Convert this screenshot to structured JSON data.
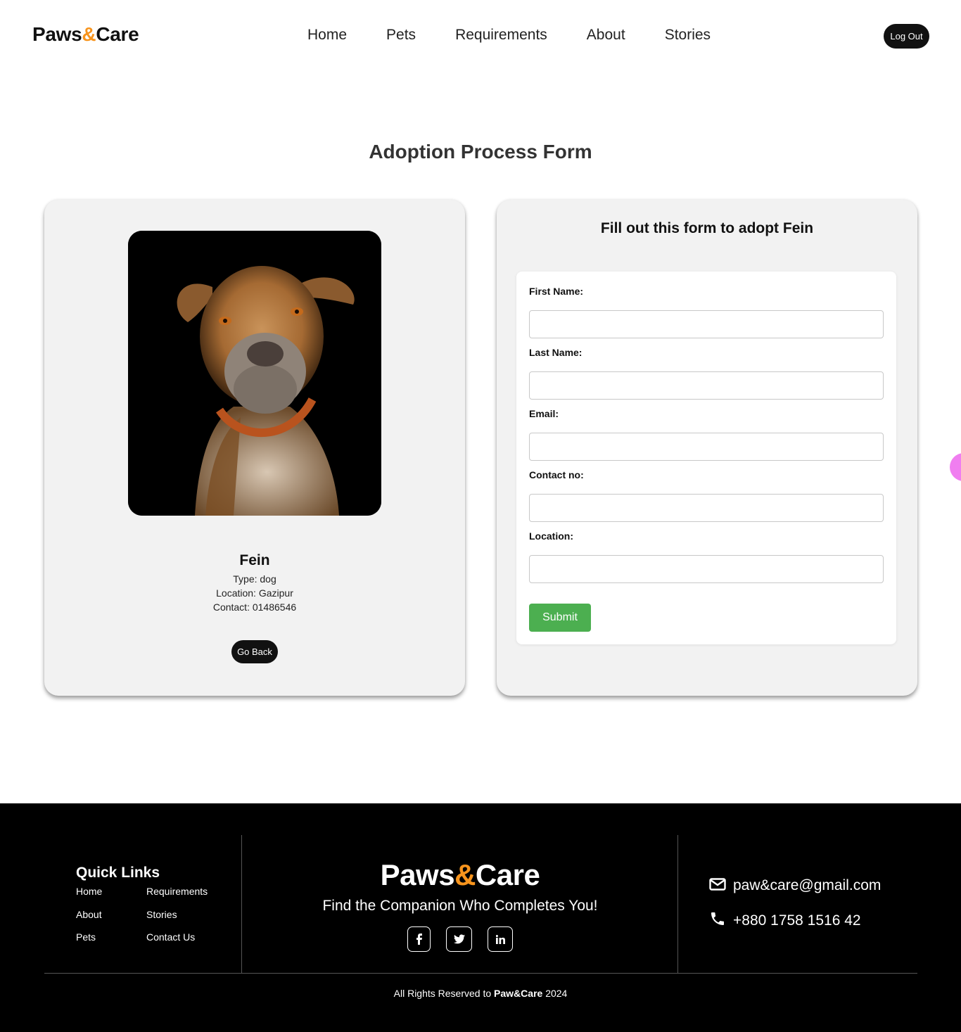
{
  "header": {
    "logo_part1": "Paws",
    "logo_amp": "&",
    "logo_part2": "Care",
    "nav": [
      "Home",
      "Pets",
      "Requirements",
      "About",
      "Stories"
    ],
    "logout_label": "Log Out"
  },
  "page_title": "Adoption Process Form",
  "pet": {
    "name": "Fein",
    "type_line": "Type: dog",
    "location_line": "Location: Gazipur",
    "contact_line": "Contact: 01486546",
    "go_back_label": "Go Back"
  },
  "form": {
    "heading": "Fill out this form to adopt Fein",
    "fields": [
      {
        "label": "First Name:",
        "value": ""
      },
      {
        "label": "Last Name:",
        "value": ""
      },
      {
        "label": "Email:",
        "value": ""
      },
      {
        "label": "Contact no:",
        "value": ""
      },
      {
        "label": "Location:",
        "value": ""
      }
    ],
    "submit_label": "Submit"
  },
  "footer": {
    "quick_links_title": "Quick Links",
    "links_col1": [
      "Home",
      "About",
      "Pets"
    ],
    "links_col2": [
      "Requirements",
      "Stories",
      "Contact Us"
    ],
    "logo_part1": "Paws",
    "logo_amp": "&",
    "logo_part2": "Care",
    "tagline": "Find the Companion Who Completes You!",
    "social_icons": [
      "facebook-icon",
      "twitter-icon",
      "linkedin-icon"
    ],
    "email": "paw&care@gmail.com",
    "phone": "+880 1758 1516 42",
    "copyright_prefix": "All Rights Reserved to ",
    "copyright_brand": "Paw&Care",
    "copyright_year": " 2024"
  },
  "colors": {
    "accent": "#f7941d",
    "submit": "#4caf50",
    "dark": "#111111",
    "card_bg": "#f2f2f2"
  }
}
